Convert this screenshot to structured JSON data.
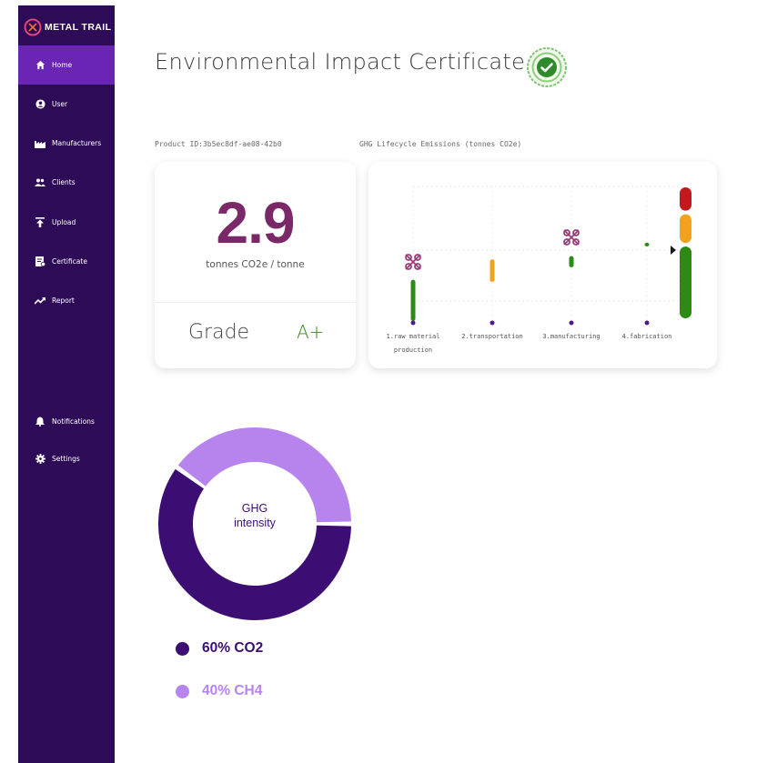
{
  "app": {
    "brand": "METAL TRAIL",
    "colors": {
      "sidebar": "#2e0b57",
      "active": "#6a25b4",
      "accent_green": "#3b8a1e",
      "score_purple": "#7a2868"
    }
  },
  "sidebar": {
    "items": [
      {
        "label": "Home",
        "icon": "home-icon",
        "active": true
      },
      {
        "label": "User",
        "icon": "user-icon",
        "active": false
      },
      {
        "label": "Manufacturers",
        "icon": "factory-icon",
        "active": false
      },
      {
        "label": "Clients",
        "icon": "group-icon",
        "active": false
      },
      {
        "label": "Upload",
        "icon": "upload-icon",
        "active": false
      },
      {
        "label": "Certificate",
        "icon": "certificate-icon",
        "active": false
      },
      {
        "label": "Report",
        "icon": "trend-icon",
        "active": false
      }
    ],
    "bottom": [
      {
        "label": "Notifications",
        "icon": "bell-icon"
      },
      {
        "label": "Settings",
        "icon": "gear-icon"
      }
    ]
  },
  "header": {
    "title": "Environmental Impact Certificate",
    "badge_icon": "certified-check-icon"
  },
  "product": {
    "id_label": "Product ID:3b5ec8df-ae08-42b0"
  },
  "score": {
    "value": "2.9",
    "unit": "tonnes CO2e / tonne",
    "grade_label": "Grade",
    "grade_value": "A+"
  },
  "chart_data": [
    {
      "type": "bar",
      "title": "GHG Lifecycle Emissions (tonnes CO2e)",
      "categories": [
        "1.raw material production",
        "2.transportation",
        "3.manufacturing",
        "4.fabrication"
      ],
      "category_lines": [
        [
          "1.raw material",
          "production"
        ],
        [
          "2.transportation"
        ],
        [
          "3.manufacturing"
        ],
        [
          "4.fabrication"
        ]
      ],
      "series": [
        {
          "values": [
            0.55,
            0.3,
            0.15,
            0.05
          ],
          "colors": [
            "#2d8a15",
            "#f2a21c",
            "#2d8a15",
            "#2d8a15"
          ]
        }
      ],
      "scale_segments": [
        {
          "color": "#c4181f",
          "share": 0.2
        },
        {
          "color": "#f2a21c",
          "share": 0.24
        },
        {
          "color": "#2d8a15",
          "share": 0.56
        }
      ],
      "marker_icons": [
        "molecule-icon",
        "molecule-icon"
      ],
      "grid": true
    },
    {
      "type": "pie",
      "title": "GHG intensity",
      "labels": [
        "60% CO2",
        "40% CH4"
      ],
      "values": [
        60,
        40
      ],
      "colors": [
        "#3c0d73",
        "#b783ed"
      ]
    }
  ],
  "donut": {
    "center_line1": "GHG",
    "center_line2": "intensity"
  }
}
